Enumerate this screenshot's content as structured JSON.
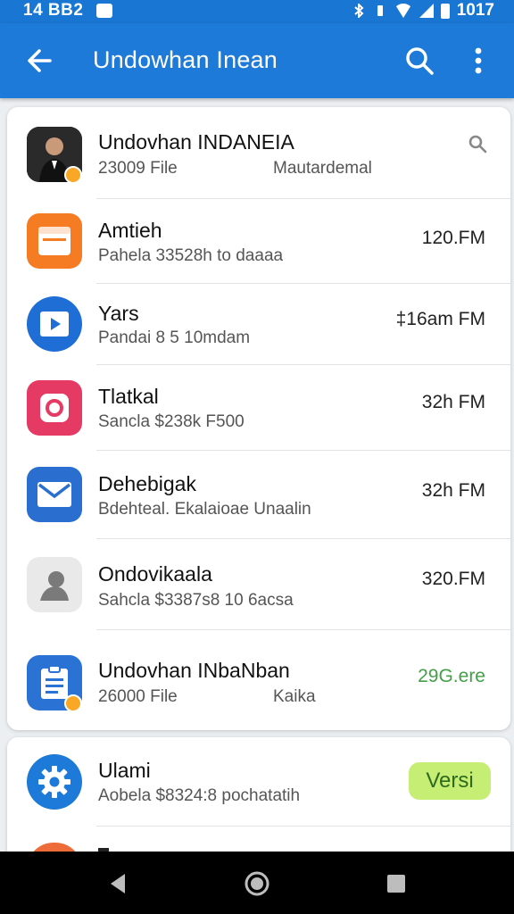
{
  "status_bar": {
    "time": "14 BB2",
    "right_time": "1017"
  },
  "app_bar": {
    "title": "Undowhan Inean"
  },
  "card_1": {
    "items": [
      {
        "title": "Undovhan INDANEIA",
        "sub": "23009 File",
        "sub2": "Mautardemal",
        "icon": "person-photo-icon",
        "color": "#1b1b1b"
      },
      {
        "title": "Amtieh",
        "sub": "Pahela 33528h to daaaa",
        "time": "120.FM",
        "icon": "browser-window-icon",
        "color": "#f57c22"
      },
      {
        "title": "Yars",
        "sub": "Pandai 8 5 10mdam",
        "time": "‡16am FM",
        "icon": "play-button-icon",
        "color": "#1e6ed6"
      },
      {
        "title": "Tlatkal",
        "sub": "Sancla $238k F500",
        "time": "32h FM",
        "icon": "camera-icon",
        "color": "#e53a63"
      },
      {
        "title": "Dehebigak",
        "sub": "Bdehteal. Ekalaioae Unaalin",
        "time": "32h FM",
        "icon": "mail-icon",
        "color": "#2a6fd0"
      },
      {
        "title": "Ondovikaala",
        "sub": "Sahcla $3387s8 10 6acsa",
        "time": "320.FM",
        "icon": "contact-silhouette-icon",
        "color": "#e9e9e9"
      },
      {
        "title": "Undovhan INbaNban",
        "sub": "26000 File",
        "sub2": "Kaika",
        "time": "29G.ere",
        "icon": "clipboard-list-icon",
        "color": "#2a73d5",
        "time_color": "#43a047"
      }
    ]
  },
  "card_2": {
    "item": {
      "title": "Ulami",
      "sub": "Aobela $8324:8 pochatatih",
      "action": "Versi",
      "icon": "gear-icon",
      "color": "#1e7ad9"
    }
  },
  "colors": {
    "app_bar": "#1e7ad9",
    "accent_green": "#c6ed74",
    "badge": "#f9a825"
  }
}
